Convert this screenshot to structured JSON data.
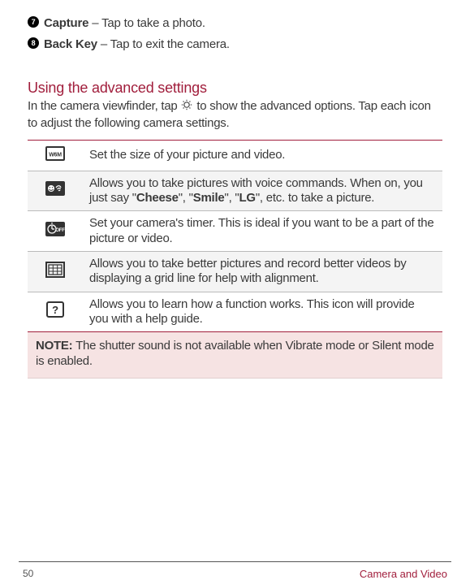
{
  "bullets": [
    {
      "num": "7",
      "label": "Capture",
      "desc": " – Tap to take a photo."
    },
    {
      "num": "8",
      "label": "Back Key",
      "desc": " – Tap to exit the camera."
    }
  ],
  "section_title": "Using the advanced settings",
  "intro_pre": "In the camera viewfinder, tap ",
  "intro_post": " to show the advanced options. Tap each icon to adjust the following camera settings.",
  "rows": [
    {
      "desc": "Set the size of your picture and video."
    },
    {
      "desc_pre": "Allows you to take pictures with voice commands. When on, you just say \"",
      "b1": "Cheese",
      "m1": "\", \"",
      "b2": "Smile",
      "m2": "\", \"",
      "b3": "LG",
      "post": "\", etc. to take a picture."
    },
    {
      "desc": "Set your camera's timer. This is ideal if you want to be a part of the picture or video."
    },
    {
      "desc": "Allows you to take better pictures and record better videos by displaying a grid line for help with alignment."
    },
    {
      "desc": "Allows you to learn how a function works. This icon will provide you with a help guide."
    }
  ],
  "note_label": "NOTE:",
  "note_text": " The shutter sound is not available when Vibrate mode or Silent mode is enabled.",
  "page_number": "50",
  "footer_label": "Camera and Video"
}
